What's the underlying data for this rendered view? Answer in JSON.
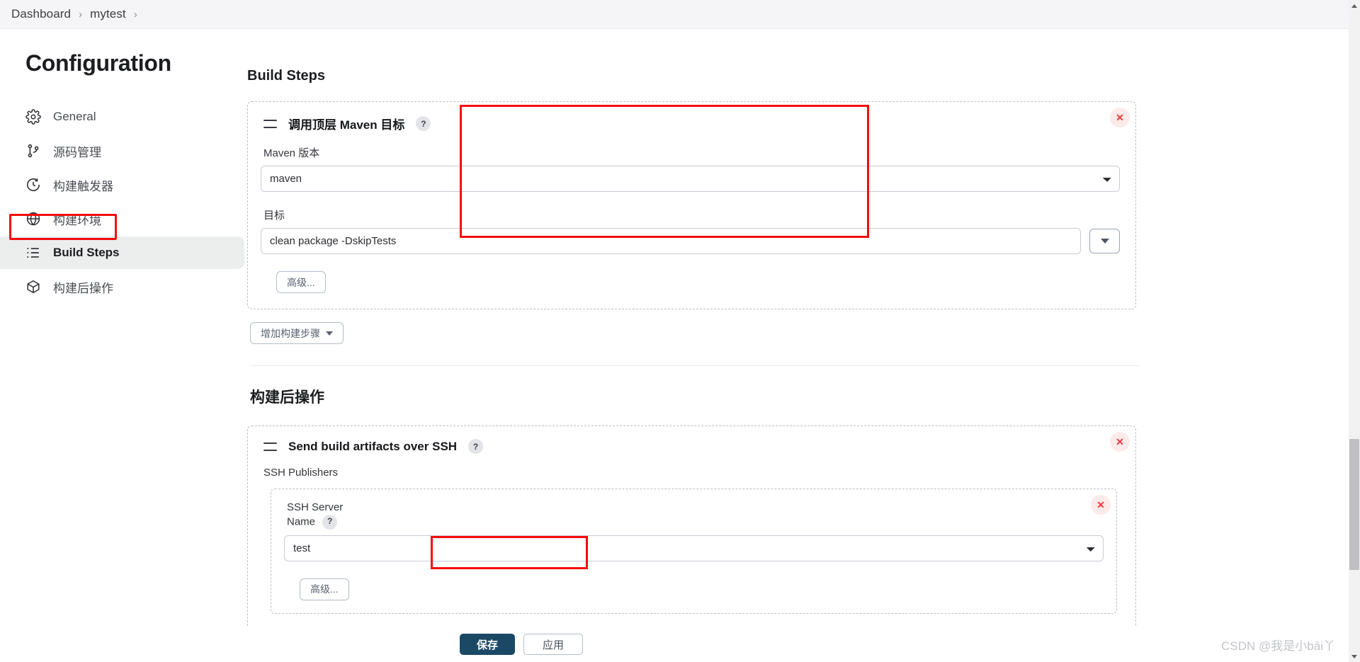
{
  "breadcrumb": {
    "items": [
      {
        "label": "Dashboard"
      },
      {
        "label": "mytest"
      }
    ],
    "separator": "›"
  },
  "sidebar": {
    "title": "Configuration",
    "items": [
      {
        "label": "General",
        "icon": "gear-icon",
        "active": false
      },
      {
        "label": "源码管理",
        "icon": "branch-icon",
        "active": false
      },
      {
        "label": "构建触发器",
        "icon": "clock-icon",
        "active": false
      },
      {
        "label": "构建环境",
        "icon": "globe-icon",
        "active": false
      },
      {
        "label": "Build Steps",
        "icon": "list-icon",
        "active": true
      },
      {
        "label": "构建后操作",
        "icon": "package-icon",
        "active": false
      }
    ]
  },
  "main": {
    "build_steps": {
      "heading": "Build Steps",
      "step": {
        "title": "调用顶层 Maven 目标",
        "help": "?",
        "delete": "✕",
        "maven_version_label": "Maven 版本",
        "maven_version_value": "maven",
        "goals_label": "目标",
        "goals_value": "clean package -DskipTests",
        "goals_dropdown": "▼",
        "advanced_button": "高级..."
      },
      "add_step_button": "增加构建步骤"
    },
    "post_build": {
      "heading": "构建后操作",
      "step": {
        "title": "Send build artifacts over SSH",
        "help": "?",
        "delete": "✕",
        "publishers_label": "SSH Publishers",
        "server": {
          "name_label_line1": "SSH Server",
          "name_label_line2": "Name",
          "help": "?",
          "delete": "✕",
          "value": "test",
          "advanced_button": "高级..."
        }
      }
    }
  },
  "footer": {
    "save_label": "保存",
    "apply_label": "应用"
  },
  "watermark": "CSDN @我是小bāi丫",
  "colors": {
    "highlight": "#f50b0b",
    "primary_button": "#1b4965",
    "delete": "#f0383b",
    "breadcrumb_bg": "#f5f5f7"
  }
}
